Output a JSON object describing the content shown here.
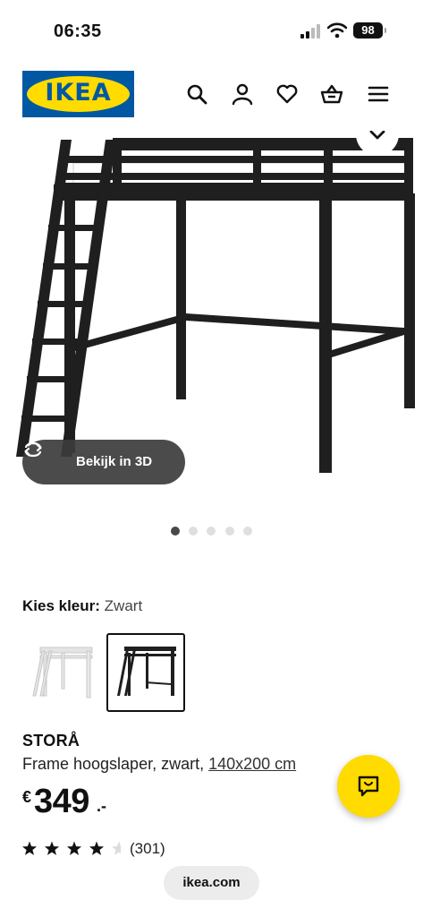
{
  "status_bar": {
    "time": "06:35",
    "battery": "98"
  },
  "header": {
    "logo_text": "IKEA",
    "icons": [
      "search-icon",
      "user-icon",
      "heart-icon",
      "basket-icon",
      "menu-icon"
    ]
  },
  "gallery": {
    "view_3d_label": "Bekijk in 3D",
    "page_count": 5,
    "active_index": 0
  },
  "color_select": {
    "label": "Kies kleur:",
    "value": "Zwart",
    "options": [
      "white",
      "black"
    ],
    "selected_index": 1
  },
  "product": {
    "name": "STORÅ",
    "description": "Frame hoogslaper, zwart, ",
    "size": "140x200 cm",
    "price_currency": "€",
    "price_int": "349",
    "price_decimal": ".-"
  },
  "rating": {
    "stars": 4,
    "max_stars": 5,
    "count": "(301)"
  },
  "browser": {
    "url": "ikea.com"
  },
  "colors": {
    "ikea_blue": "#0058a3",
    "ikea_yellow": "#ffdb00",
    "bed_black": "#1f1f1f"
  }
}
